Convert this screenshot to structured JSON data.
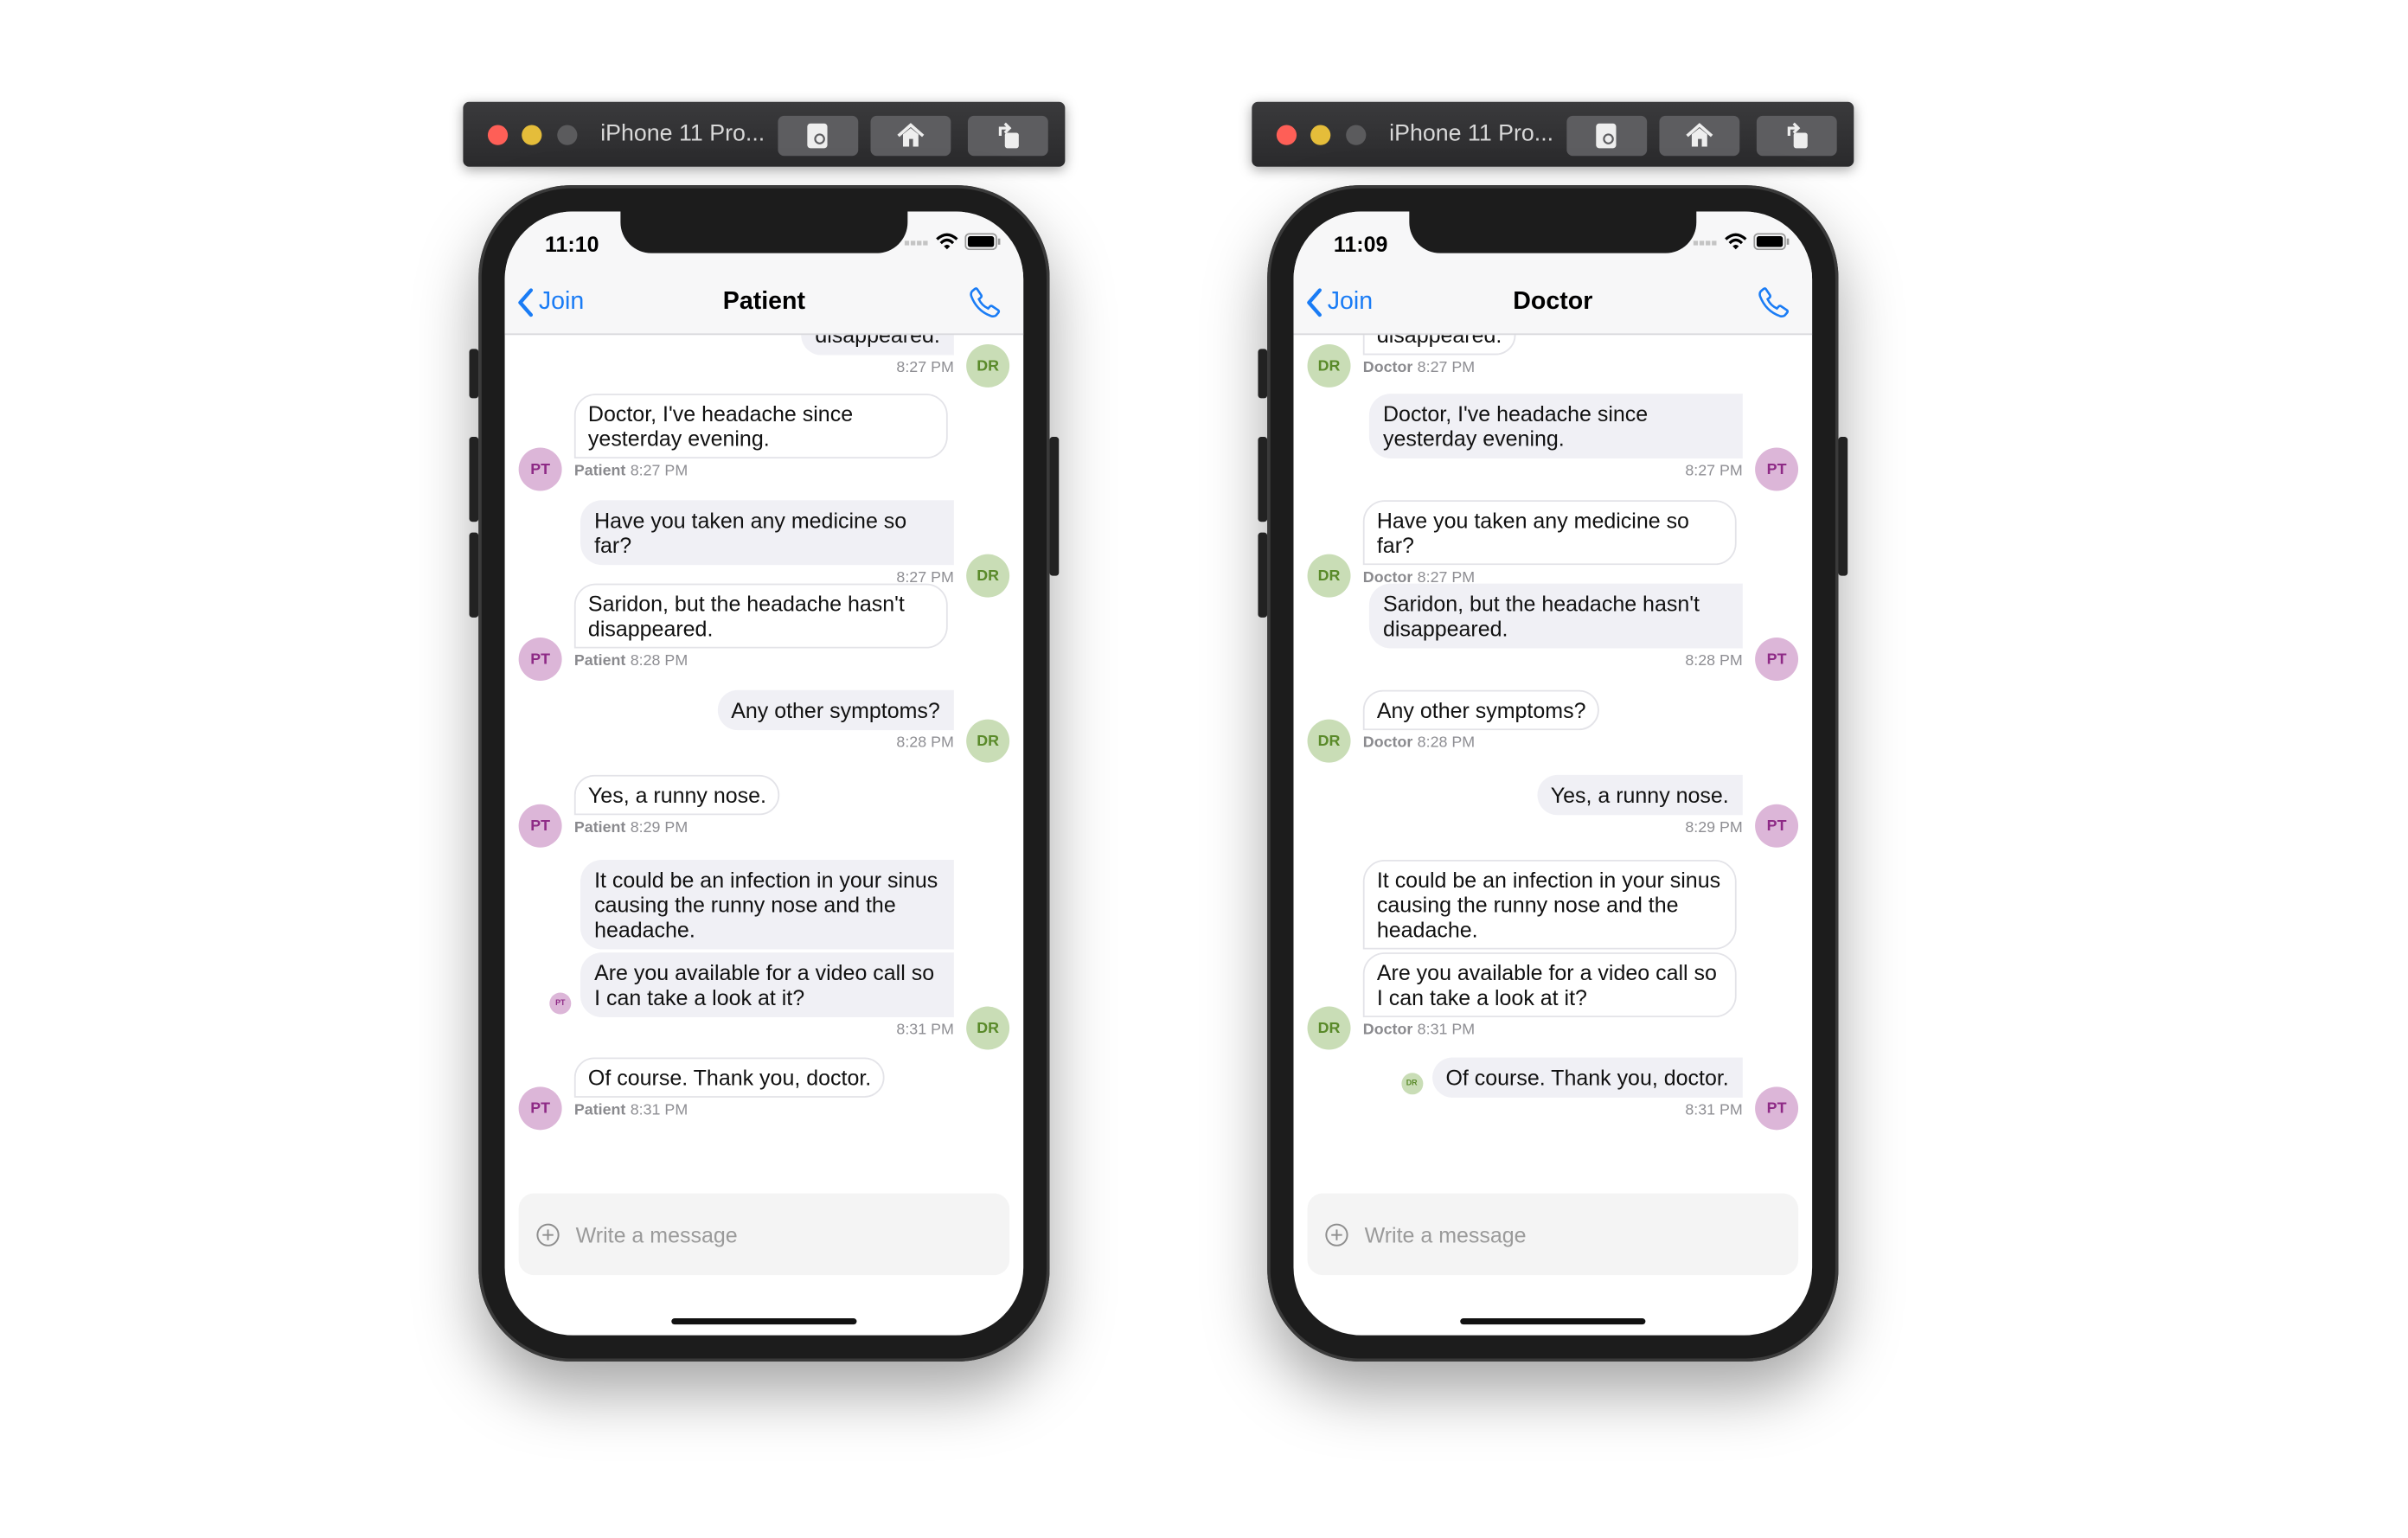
{
  "colors": {
    "accent": "#1a7cf5",
    "patient_avatar_bg": "#dcb6d8",
    "patient_avatar_fg": "#8e2a86",
    "doctor_avatar_bg": "#c9ddb6",
    "doctor_avatar_fg": "#5a8a2a",
    "outgoing_bubble": "#f0f0f5"
  },
  "phones": [
    {
      "toolbar": {
        "title": "iPhone 11 Pro...",
        "icons": [
          "screenshot-icon",
          "home-icon",
          "rotate-icon"
        ]
      },
      "status_time": "11:10",
      "nav": {
        "back_label": "Join",
        "title": "Patient",
        "call_icon": "phone-icon"
      },
      "messages": [
        {
          "side": "out",
          "text": "disappeared.",
          "time": "8:27 PM",
          "avatar": "DR",
          "role": "doctor"
        },
        {
          "side": "in",
          "text": "Doctor, I've headache since yesterday evening.",
          "sender": "Patient",
          "time": "8:27 PM",
          "avatar": "PT",
          "role": "patient"
        },
        {
          "side": "out",
          "text": "Have you taken any medicine so far?",
          "time": "8:27 PM",
          "avatar": "DR",
          "role": "doctor"
        },
        {
          "side": "in",
          "text": "Saridon, but the headache hasn't disappeared.",
          "sender": "Patient",
          "time": "8:28 PM",
          "avatar": "PT",
          "role": "patient"
        },
        {
          "side": "out",
          "text": "Any other symptoms?",
          "time": "8:28 PM",
          "avatar": "DR",
          "role": "doctor"
        },
        {
          "side": "in",
          "text": "Yes, a runny nose.",
          "sender": "Patient",
          "time": "8:29 PM",
          "avatar": "PT",
          "role": "patient"
        },
        {
          "side": "out",
          "text": "It could be an infection in your sinus causing the runny nose and the headache.",
          "grouped": true,
          "role": "doctor"
        },
        {
          "side": "out",
          "text": "Are you available for a video call so I can take a look at it?",
          "time": "8:31 PM",
          "avatar": "DR",
          "role": "doctor",
          "receipt": "PT"
        },
        {
          "side": "in",
          "text": "Of course. Thank you, doctor.",
          "sender": "Patient",
          "time": "8:31 PM",
          "avatar": "PT",
          "role": "patient"
        }
      ],
      "input": {
        "placeholder": "Write a message",
        "icon": "plus-circle-icon"
      }
    },
    {
      "toolbar": {
        "title": "iPhone 11 Pro...",
        "icons": [
          "screenshot-icon",
          "home-icon",
          "rotate-icon"
        ]
      },
      "status_time": "11:09",
      "nav": {
        "back_label": "Join",
        "title": "Doctor",
        "call_icon": "phone-icon"
      },
      "messages": [
        {
          "side": "in",
          "text": "disappeared.",
          "sender": "Doctor",
          "time": "8:27 PM",
          "avatar": "DR",
          "role": "doctor"
        },
        {
          "side": "out",
          "text": "Doctor, I've headache since yesterday evening.",
          "time": "8:27 PM",
          "avatar": "PT",
          "role": "patient"
        },
        {
          "side": "in",
          "text": "Have you taken any medicine so far?",
          "sender": "Doctor",
          "time": "8:27 PM",
          "avatar": "DR",
          "role": "doctor"
        },
        {
          "side": "out",
          "text": "Saridon, but the headache hasn't disappeared.",
          "time": "8:28 PM",
          "avatar": "PT",
          "role": "patient"
        },
        {
          "side": "in",
          "text": "Any other symptoms?",
          "sender": "Doctor",
          "time": "8:28 PM",
          "avatar": "DR",
          "role": "doctor"
        },
        {
          "side": "out",
          "text": "Yes, a runny nose.",
          "time": "8:29 PM",
          "avatar": "PT",
          "role": "patient"
        },
        {
          "side": "in",
          "text": "It could be an infection in your sinus causing the runny nose and the headache.",
          "grouped": true,
          "role": "doctor"
        },
        {
          "side": "in",
          "text": "Are you available for a video call so I can take a look at it?",
          "sender": "Doctor",
          "time": "8:31 PM",
          "avatar": "DR",
          "role": "doctor"
        },
        {
          "side": "out",
          "text": "Of course. Thank you, doctor.",
          "time": "8:31 PM",
          "avatar": "PT",
          "role": "patient",
          "receipt": "DR"
        }
      ],
      "input": {
        "placeholder": "Write a message",
        "icon": "plus-circle-icon"
      }
    }
  ]
}
